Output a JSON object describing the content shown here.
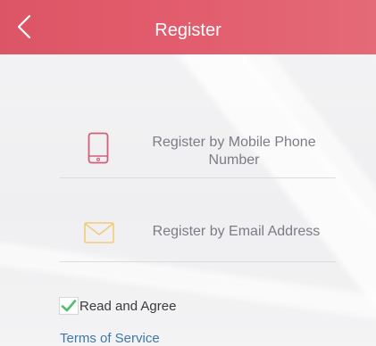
{
  "header": {
    "title": "Register",
    "back_icon": "chevron-left-icon",
    "background": "#e25d6d"
  },
  "options": [
    {
      "label": "Register by Mobile Phone Number",
      "icon": "mobile-phone-icon",
      "icon_color": "#d25f7a"
    },
    {
      "label": "Register by Email Address",
      "icon": "envelope-icon",
      "icon_color": "#f2cc7a"
    }
  ],
  "agreement": {
    "label": "Read and Agree",
    "checked": true,
    "check_color": "#4fbf6a",
    "terms_link": "Terms of Service",
    "link_color": "#3f78a8"
  }
}
